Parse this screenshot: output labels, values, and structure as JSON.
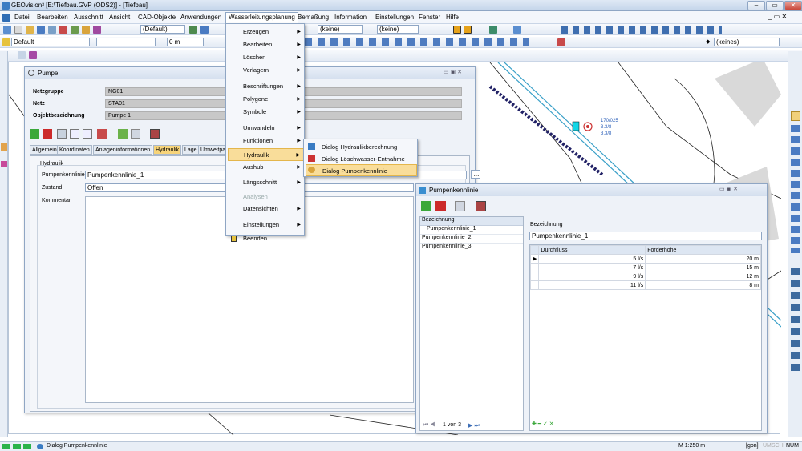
{
  "app": {
    "title": "GEOvision³ [E:\\Tiefbau.GVP (ODS2)] - [Tiefbau]"
  },
  "menubar": [
    "Datei",
    "Bearbeiten",
    "Ausschnitt",
    "Ansicht",
    "CAD-Objekte",
    "Anwendungen",
    "Wasserleitungsplanung",
    "Bemaßung",
    "Information",
    "Einstellungen",
    "Fenster",
    "Hilfe"
  ],
  "toolbar2": {
    "style": "(Default)",
    "line": "(keine)",
    "fill": "(keine)",
    "layer": "Default",
    "offset": "0 m",
    "symbol": "(keines)"
  },
  "dropdown": [
    {
      "label": "Erzeugen",
      "sub": true
    },
    {
      "label": "Bearbeiten",
      "sub": true
    },
    {
      "label": "Löschen",
      "sub": true
    },
    {
      "label": "Verlagern",
      "sub": true
    },
    {
      "label": "Beschriftungen",
      "sub": true
    },
    {
      "label": "Polygone",
      "sub": true
    },
    {
      "label": "Symbole",
      "sub": true
    },
    {
      "label": "Umwandeln",
      "sub": true
    },
    {
      "label": "Funktionen",
      "sub": true
    },
    {
      "label": "Hydraulik",
      "sub": true
    },
    {
      "label": "Aushub",
      "sub": true
    },
    {
      "label": "Längsschnitt",
      "sub": true
    },
    {
      "label": "Analysen",
      "sub": false
    },
    {
      "label": "Datensichten",
      "sub": true
    },
    {
      "label": "Einstellungen",
      "sub": true
    },
    {
      "label": "Beenden",
      "sub": false
    }
  ],
  "submenu": [
    "Dialog Hydraulikberechnung",
    "Dialog Löschwasser-Entnahme",
    "Dialog Pumpenkennlinie"
  ],
  "pumpe": {
    "title": "Pumpe",
    "netzgruppe_label": "Netzgruppe",
    "netzgruppe": "NG01",
    "netz_label": "Netz",
    "netz": "STA01",
    "objekt_label": "Objektbezeichnung",
    "objekt": "Pumpe 1",
    "tabs": [
      "Allgemein",
      "Koordinaten",
      "Anlageninformationen",
      "Hydraulik",
      "Lage",
      "Umweltpa"
    ],
    "group": "Hydraulik",
    "pk_label": "Pumpenkennlinie",
    "pk_value": "Pumpenkennlinie_1",
    "zustand_label": "Zustand",
    "zustand": "Offen",
    "kommentar_label": "Kommentar",
    "browse": "..."
  },
  "pumpenkennlinie": {
    "title": "Pumpenkennlinie",
    "list_header": "Bezeichnung",
    "items": [
      "Pumpenkennlinie_1",
      "Pumpenkennlinie_2",
      "Pumpenkennlinie_3"
    ],
    "bez_label": "Bezeichnung",
    "bez_value": "Pumpenkennlinie_1",
    "col1": "Durchfluss",
    "col2": "Förderhöhe",
    "rows": [
      [
        "5 l/s",
        "20 m"
      ],
      [
        "7 l/s",
        "15 m"
      ],
      [
        "9 l/s",
        "12 m"
      ],
      [
        "11 l/s",
        "8 m"
      ]
    ],
    "pager": "1 von 3"
  },
  "map": {
    "label1": "170/025",
    "label2": "3.3/8",
    "label3": "3.3/8"
  },
  "status": {
    "text": "Dialog Pumpenkennlinie",
    "scale": "M 1:250 m",
    "gon": "[gon]",
    "umsch": "UMSCH",
    "num": "NUM"
  }
}
